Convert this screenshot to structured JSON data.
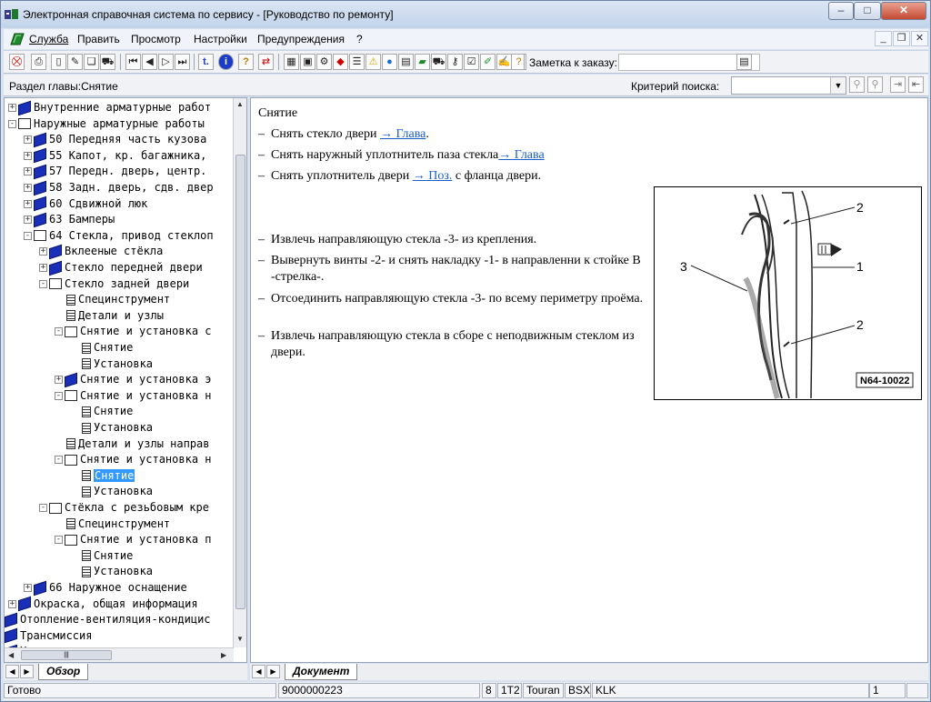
{
  "window": {
    "title": "Электронная справочная система по сервису - [Руководство по ремонту]",
    "buttons": {
      "minimize": "–",
      "maximize": "□",
      "close": "✕"
    }
  },
  "menu": {
    "items": [
      "Служба",
      "Править",
      "Просмотр",
      "Настройки",
      "Предупреждения",
      "?"
    ],
    "mdi": {
      "minimize": "_",
      "restore": "❐",
      "close": "✕"
    }
  },
  "toolbar": {
    "note_label": "Заметка к заказу:",
    "note_value": "",
    "btn_t": "t.",
    "btn_info": "i",
    "btn_help": "?"
  },
  "subbar": {
    "section_label": "Раздел главы:Снятие",
    "criteria_label": "Критерий  поиска:",
    "criteria_value": ""
  },
  "tree": {
    "nodes": [
      {
        "label": "Внутренние арматурные работ"
      },
      {
        "label": "Наружные арматурные работы"
      },
      {
        "label": "50 Передняя часть кузова"
      },
      {
        "label": "55 Капот, кр. багажника,"
      },
      {
        "label": "57 Передн. дверь, центр."
      },
      {
        "label": "58 Задн. дверь, сдв. двер"
      },
      {
        "label": "60 Сдвижной люк"
      },
      {
        "label": "63 Бамперы"
      },
      {
        "label": "64 Стекла, привод стеклоп"
      },
      {
        "label": "Вклееные стёкла"
      },
      {
        "label": "Стекло передней двери"
      },
      {
        "label": "Стекло задней двери"
      },
      {
        "label": "Специнструмент"
      },
      {
        "label": "Детали и узлы"
      },
      {
        "label": "Снятие и установка с"
      },
      {
        "label": "Снятие"
      },
      {
        "label": "Установка"
      },
      {
        "label": "Снятие и установка э"
      },
      {
        "label": "Снятие и установка н"
      },
      {
        "label": "Снятие"
      },
      {
        "label": "Установка"
      },
      {
        "label": "Детали и узлы направ"
      },
      {
        "label": "Снятие и установка н"
      },
      {
        "label": "Снятие"
      },
      {
        "label": "Установка"
      },
      {
        "label": "Стёкла с резьбовым кре"
      },
      {
        "label": "Специнструмент"
      },
      {
        "label": "Снятие и установка п"
      },
      {
        "label": "Снятие"
      },
      {
        "label": "Установка"
      },
      {
        "label": "66 Наружное оснащение"
      },
      {
        "label": "Окраска, общая информация"
      },
      {
        "label": "Отопление-вентиляция-кондицис"
      },
      {
        "label": "Трансмиссия"
      },
      {
        "label": "Ходовая часть"
      }
    ],
    "hscroll_grip": "|||"
  },
  "document": {
    "heading": "Снятие",
    "step1": {
      "text": "Снять стекло двери ",
      "link": "→ Глава",
      "after": "."
    },
    "step2": {
      "text": "Снять наружный уплотнитель паза стекла",
      "link": "→ Глава",
      "after": ""
    },
    "step3": {
      "text": "Снять уплотнитель двери ",
      "link": "→ Поз.",
      "after": " с фланца двери."
    },
    "steps": [
      "Извлечь направляющую стекла -3- из крепления.",
      "Вывернуть винты -2- и снять накладку -1- в направленни к стойке В -стрелка-.",
      "Отсоединить направляющую стекла -3- по всему периметру проёма.",
      "Извлечь направляющую стекла в сборе с неподвижным стеклом из двери."
    ],
    "bullet": "–",
    "figure": {
      "labels": [
        "2",
        "1",
        "2",
        "3"
      ],
      "code": "N64-10022"
    }
  },
  "tabs": {
    "left": "Обзор",
    "right": "Документ"
  },
  "statusbar": {
    "status": "Готово",
    "order": "9000000223",
    "f1": "8",
    "f2": "1T2",
    "f3": "Touran",
    "f4": "BSX",
    "f5": "KLK",
    "page": "1"
  }
}
